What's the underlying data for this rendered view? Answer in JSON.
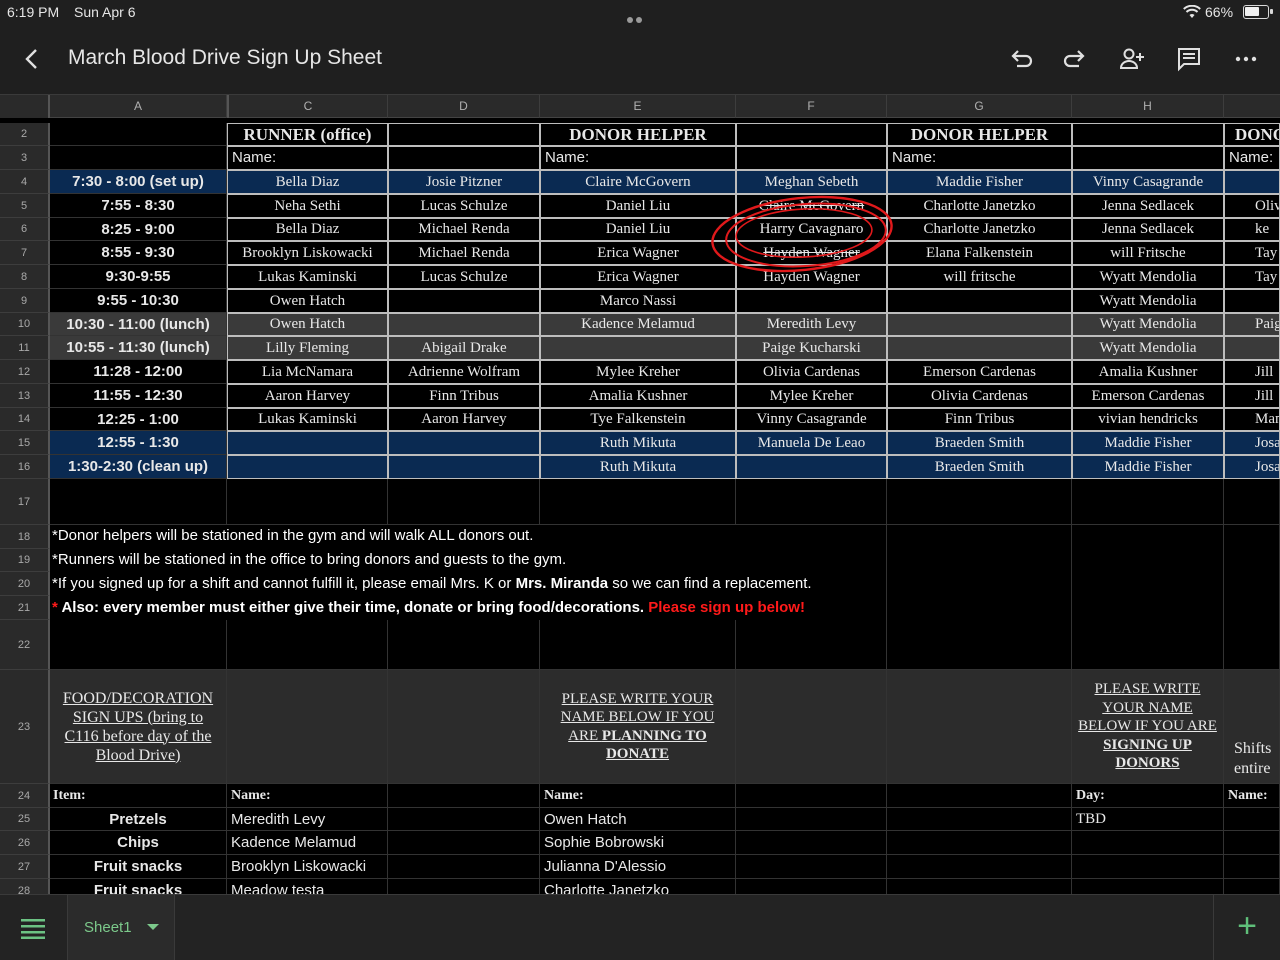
{
  "status_bar": {
    "time": "6:19 PM",
    "date": "Sun Apr 6",
    "battery": "66%",
    "battery_level": 0.66
  },
  "title_bar": {
    "title": "March Blood Drive Sign Up Sheet",
    "icons": [
      "back-icon",
      "undo-icon",
      "redo-icon",
      "share-icon",
      "comment-icon",
      "more-icon"
    ]
  },
  "columns": [
    "A",
    "C",
    "D",
    "E",
    "F",
    "G",
    "H"
  ],
  "row_numbers": [
    "2",
    "3",
    "4",
    "5",
    "6",
    "7",
    "8",
    "9",
    "10",
    "11",
    "12",
    "13",
    "14",
    "15",
    "16",
    "17",
    "18",
    "19",
    "20",
    "21",
    "22",
    "23",
    "24",
    "25",
    "26",
    "27",
    "28"
  ],
  "headers": {
    "runner": "RUNNER (office)",
    "donor_helper_1": "DONOR HELPER",
    "donor_helper_2": "DONOR HELPER",
    "donor_cut": "DONO",
    "name_c": "Name:",
    "name_e": "Name:",
    "name_g": "Name:",
    "name_i": "Name:"
  },
  "schedule": [
    {
      "time": "7:30 - 8:00 (set up)",
      "C": "Bella Diaz",
      "D": "Josie Pitzner",
      "E": "Claire McGovern",
      "F": "Meghan Sebeth",
      "G": "Maddie Fisher",
      "H": "Vinny Casagrande",
      "I": ""
    },
    {
      "time": "7:55 - 8:30",
      "C": "Neha Sethi",
      "D": "Lucas Schulze",
      "E": "Daniel Liu",
      "F": "Claire McGovern",
      "G": "Charlotte Janetzko",
      "H": "Jenna Sedlacek",
      "I": "Oliv"
    },
    {
      "time": "8:25 - 9:00",
      "C": "Bella Diaz",
      "D": "Michael Renda",
      "E": "Daniel Liu",
      "F": "Harry Cavagnaro",
      "G": "Charlotte Janetzko",
      "H": "Jenna Sedlacek",
      "I": "ke"
    },
    {
      "time": "8:55 - 9:30",
      "C": "Brooklyn Liskowacki",
      "D": "Michael Renda",
      "E": "Erica Wagner",
      "F": "Hayden Wagner",
      "G": "Elana Falkenstein",
      "H": "will Fritsche",
      "I": "Tay"
    },
    {
      "time": "9:30-9:55",
      "C": "Lukas Kaminski",
      "D": "Lucas Schulze",
      "E": "Erica Wagner",
      "F": "Hayden Wagner",
      "G": "will fritsche",
      "H": "Wyatt Mendolia",
      "I": "Tay"
    },
    {
      "time": "9:55 - 10:30",
      "C": "Owen Hatch",
      "D": "",
      "E": "Marco Nassi",
      "F": "",
      "G": "",
      "H": "Wyatt Mendolia",
      "I": ""
    },
    {
      "time": "10:30 - 11:00 (lunch)",
      "C": "Owen Hatch",
      "D": "",
      "E": "Kadence Melamud",
      "F": "Meredith Levy",
      "G": "",
      "H": "Wyatt Mendolia",
      "I": "Paig"
    },
    {
      "time": "10:55 - 11:30 (lunch)",
      "C": "Lilly Fleming",
      "D": "Abigail Drake",
      "E": "",
      "F": "Paige Kucharski",
      "G": "",
      "H": "Wyatt Mendolia",
      "I": ""
    },
    {
      "time": "11:28 - 12:00",
      "C": "Lia McNamara",
      "D": "Adrienne Wolfram",
      "E": "Mylee Kreher",
      "F": "Olivia Cardenas",
      "G": "Emerson Cardenas",
      "H": "Amalia Kushner",
      "I": "Jill"
    },
    {
      "time": "11:55 - 12:30",
      "C": "Aaron Harvey",
      "D": "Finn Tribus",
      "E": "Amalia Kushner",
      "F": "Mylee Kreher",
      "G": "Olivia Cardenas",
      "H": "Emerson Cardenas",
      "I": "Jill"
    },
    {
      "time": "12:25 - 1:00",
      "C": "Lukas Kaminski",
      "D": "Aaron Harvey",
      "E": "Tye Falkenstein",
      "F": "Vinny Casagrande",
      "G": "Finn Tribus",
      "H": "vivian hendricks",
      "I": "Manu"
    },
    {
      "time": "12:55 - 1:30",
      "C": "",
      "D": "",
      "E": "Ruth Mikuta",
      "F": "Manuela De Leao",
      "G": "Braeden Smith",
      "H": "Maddie Fisher",
      "I": "Josa"
    },
    {
      "time": "1:30-2:30 (clean up)",
      "C": "",
      "D": "",
      "E": "Ruth Mikuta",
      "F": "",
      "G": "Braeden Smith",
      "H": "Maddie Fisher",
      "I": "Josa"
    }
  ],
  "notes": {
    "n18": "*Donor helpers will be stationed in the gym and will walk ALL donors out.",
    "n19": "*Runners will be stationed in the office to bring donors and guests to the gym.",
    "n20a": "*If you signed up for a shift and cannot fulfill it, please email Mrs. K or ",
    "n20b": "Mrs. Miranda",
    "n20c": " so we can find a replacement.",
    "n21a": "* ",
    "n21b": "Also: every member must either give their time, donate or bring food/decorations. ",
    "n21c": "Please sign up below!"
  },
  "signup": {
    "food_header": "FOOD/DECORATION SIGN UPS (bring to C116 before day of the Blood Drive)",
    "donate_a": "PLEASE WRITE YOUR NAME BELOW IF YOU ARE ",
    "donate_b": "PLANNING TO DONATE",
    "donors_a": "PLEASE WRITE YOUR NAME BELOW IF YOU ARE ",
    "donors_b": "SIGNING UP DONORS",
    "shifts_cut_1": "Shifts",
    "shifts_cut_2": "entire",
    "item_label": "Item:",
    "name_label_c": "Name:",
    "name_label_e": "Name:",
    "day_label": "Day:",
    "name_label_i": "Name:",
    "items": [
      {
        "item": "Pretzels",
        "name": "Meredith Levy",
        "donor": "Owen Hatch",
        "day": "TBD"
      },
      {
        "item": "Chips",
        "name": "Kadence Melamud",
        "donor": "Sophie Bobrowski",
        "day": ""
      },
      {
        "item": "Fruit snacks",
        "name": "Brooklyn Liskowacki",
        "donor": "Julianna D'Alessio",
        "day": ""
      },
      {
        "item": "Fruit snacks",
        "name": "Meadow testa",
        "donor": "Charlotte Janetzko",
        "day": ""
      }
    ]
  },
  "bottom_bar": {
    "sheet_name": "Sheet1"
  },
  "colors": {
    "blue_row": "#0a2a52",
    "grey_row": "#3a3a3a",
    "red_text": "#ff1a1a",
    "green_accent": "#5fbf7a"
  }
}
